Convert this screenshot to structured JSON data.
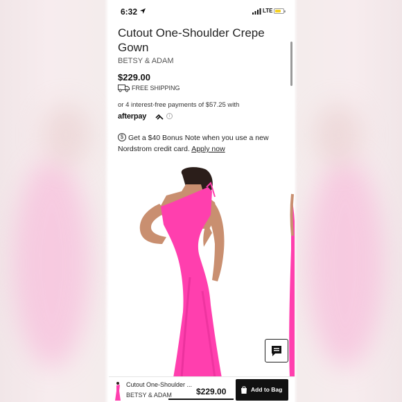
{
  "status_bar": {
    "time": "6:32",
    "network": "LTE",
    "icons": [
      "location-arrow-icon",
      "signal-bars-icon",
      "battery-icon"
    ],
    "battery_color": "#f5d020"
  },
  "product": {
    "title": "Cutout One-Shoulder Crepe Gown",
    "brand": "BETSY & ADAM",
    "price": "$229.00",
    "shipping": "FREE SHIPPING",
    "installments": "or 4 interest-free payments of $57.25 with",
    "afterpay": "afterpay",
    "bonus_text": "Get a $40 Bonus Note when you use a new Nordstrom credit card.",
    "apply_link": "Apply now",
    "dress_color": "#ff3fae"
  },
  "bottom_bar": {
    "mini_title": "Cutout One-Shoulder ...",
    "mini_brand": "BETSY & ADAM",
    "mini_price": "$229.00",
    "add_to_bag": "Add to Bag"
  },
  "colors": {
    "accent_dark": "#111111",
    "dress_pink": "#ff3fae"
  }
}
